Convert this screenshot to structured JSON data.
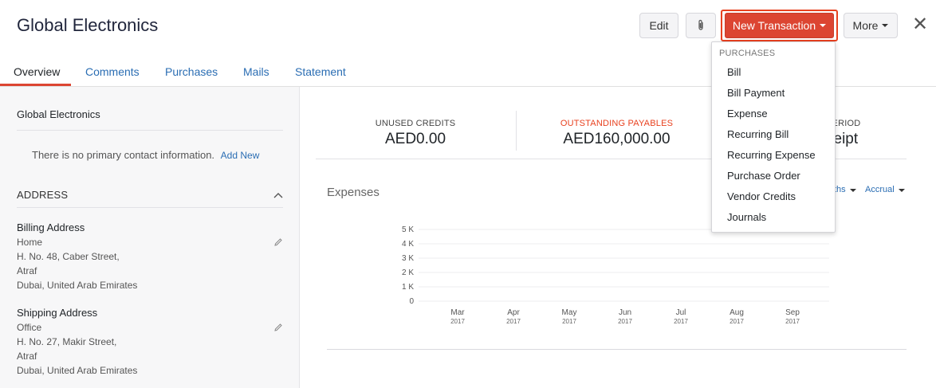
{
  "header": {
    "title": "Global Electronics",
    "edit_label": "Edit",
    "attach_icon": "paperclip-icon",
    "new_transaction_label": "New Transaction",
    "more_label": "More",
    "close_glyph": "✕"
  },
  "tabs": [
    {
      "label": "Overview",
      "active": true
    },
    {
      "label": "Comments"
    },
    {
      "label": "Purchases"
    },
    {
      "label": "Mails"
    },
    {
      "label": "Statement"
    }
  ],
  "left": {
    "name": "Global Electronics",
    "no_contact": "There is no primary contact information.",
    "add_new": "Add New",
    "address_heading": "ADDRESS",
    "billing": {
      "heading": "Billing Address",
      "lines": [
        "Home",
        "H. No. 48, Caber Street,",
        "Atraf",
        "Dubai, United Arab Emirates"
      ]
    },
    "shipping": {
      "heading": "Shipping Address",
      "lines": [
        "Office",
        "H. No. 27, Makir Street,",
        "Atraf",
        "Dubai, United Arab Emirates"
      ]
    }
  },
  "stats": {
    "unused_credits_label": "UNUSED CREDITS",
    "unused_credits_value": "AED0.00",
    "outstanding_label": "OUTSTANDING PAYABLES",
    "outstanding_value": "AED160,000.00",
    "period_label_partial": "PERIOD",
    "period_value_partial": "ceipt"
  },
  "expenses": {
    "title": "Expenses",
    "filter_period_partial": "ths",
    "filter_basis": "Accrual"
  },
  "chart_data": {
    "type": "bar",
    "categories": [
      "Mar 2017",
      "Apr 2017",
      "May 2017",
      "Jun 2017",
      "Jul 2017",
      "Aug 2017",
      "Sep 2017"
    ],
    "x_month_labels": [
      "Mar",
      "Apr",
      "May",
      "Jun",
      "Jul",
      "Aug",
      "Sep"
    ],
    "x_year_labels": [
      "2017",
      "2017",
      "2017",
      "2017",
      "2017",
      "2017",
      "2017"
    ],
    "values": [
      0,
      0,
      0,
      0,
      0,
      0,
      0
    ],
    "y_ticks": [
      "5 K",
      "4 K",
      "3 K",
      "2 K",
      "1 K",
      "0"
    ],
    "ylim": [
      0,
      5000
    ],
    "grid": true
  },
  "menu": {
    "heading": "PURCHASES",
    "items": [
      "Bill",
      "Bill Payment",
      "Expense",
      "Recurring Bill",
      "Recurring Expense",
      "Purchase Order",
      "Vendor Credits",
      "Journals"
    ]
  },
  "colors": {
    "accent": "#dc4532",
    "link": "#2a6db3",
    "outstanding_label": "#e8411f"
  }
}
